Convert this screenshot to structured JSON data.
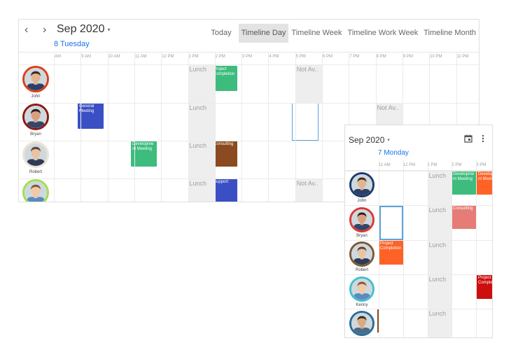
{
  "main": {
    "prev_icon": "chevron-left-icon",
    "next_icon": "chevron-right-icon",
    "month_title": "Sep 2020",
    "dropdown_icon": "caret-down-icon",
    "views": [
      "Today",
      "Timeline Day",
      "Timeline Week",
      "Timeline Work Week",
      "Timeline Month"
    ],
    "active_view": "Timeline Day",
    "date_label": "8 Tuesday",
    "hours": [
      "AM",
      "9 AM",
      "10 AM",
      "11 AM",
      "12 PM",
      "1 PM",
      "2 PM",
      "3 PM",
      "4 PM",
      "5 PM",
      "6 PM",
      "7 PM",
      "8 PM",
      "9 PM",
      "10 PM",
      "11 PM"
    ],
    "resources": [
      "John",
      "Bryan",
      "Robert",
      ""
    ],
    "lunch_label": "Lunch",
    "not_available_label": "Not Av..",
    "appointments": [
      {
        "text": "Project Completion",
        "color": "#3dbc7d"
      },
      {
        "text": "General Meeting",
        "color": "#3b4fc4"
      },
      {
        "text": "Developme nt Meeting",
        "color": "#3dbc7d"
      },
      {
        "text": "Consulting",
        "color": "#8b4a1f"
      },
      {
        "text": "Support",
        "color": "#3b4fc4"
      }
    ],
    "ring_colors": [
      "#d9401b",
      "#8b1a12",
      "#ece4d4",
      "#9fe050"
    ]
  },
  "mobile": {
    "month_title": "Sep 2020",
    "dropdown_icon": "caret-down-icon",
    "calendar_icon": "calendar-icon",
    "more_icon": "more-vert-icon",
    "date_label": "7 Monday",
    "hours": [
      "11 AM",
      "12 PM",
      "1 PM",
      "2 PM",
      "3 PM"
    ],
    "resources": [
      "John",
      "Bryan",
      "Robert",
      "Kenny",
      ""
    ],
    "lunch_label": "Lunch",
    "appointments": [
      {
        "text": "Developme nt Meeting",
        "color": "#3dbc7d"
      },
      {
        "text": "Develop nt Meeti",
        "color": "#ff6226"
      },
      {
        "text": "Consulting",
        "color": "#e57c76"
      },
      {
        "text": "Project Completion",
        "color": "#ff6226"
      },
      {
        "text": "Project Comple",
        "color": "#cc0e0e"
      }
    ],
    "ring_colors": [
      "#1d3b6e",
      "#d83a35",
      "#7a5a3a",
      "#43c0cc",
      "#286e9c"
    ]
  }
}
